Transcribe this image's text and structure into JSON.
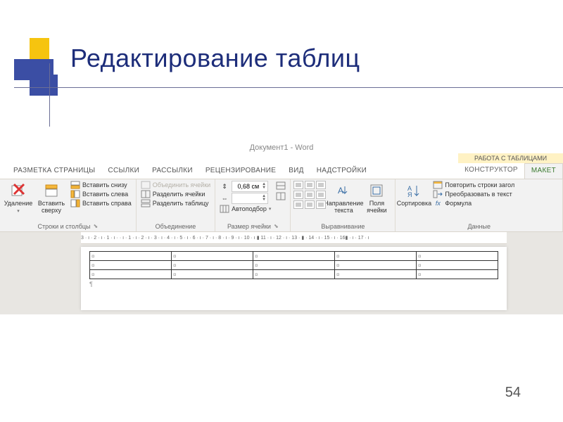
{
  "slide": {
    "title": "Редактирование таблиц",
    "number": "54"
  },
  "window": {
    "title": "Документ1 - Word"
  },
  "tabs": {
    "items": [
      "РАЗМЕТКА СТРАНИЦЫ",
      "ССЫЛКИ",
      "РАССЫЛКИ",
      "РЕЦЕНЗИРОВАНИЕ",
      "ВИД",
      "НАДСТРОЙКИ"
    ],
    "context_header": "РАБОТА С ТАБЛИЦАМИ",
    "context_items": [
      "КОНСТРУКТОР",
      "МАКЕТ"
    ],
    "active": "МАКЕТ"
  },
  "ribbon": {
    "rows_cols": {
      "delete": "Удаление",
      "insert_above": "Вставить сверху",
      "insert_below": "Вставить снизу",
      "insert_left": "Вставить слева",
      "insert_right": "Вставить справа",
      "label": "Строки и столбцы"
    },
    "merge": {
      "merge_cells": "Объединить ячейки",
      "split_cells": "Разделить ячейки",
      "split_table": "Разделить таблицу",
      "label": "Объединение"
    },
    "size": {
      "height": "0,68 см",
      "width": "",
      "autofit": "Автоподбор",
      "label": "Размер ячейки"
    },
    "align": {
      "direction": "Направление текста",
      "margins": "Поля ячейки",
      "label": "Выравнивание"
    },
    "data": {
      "sort": "Сортировка",
      "repeat": "Повторить строки загол",
      "convert": "Преобразовать в текст",
      "formula": "Формула",
      "label": "Данные"
    }
  },
  "ruler_text": "3 · ı · 2 · ı · 1 · ı ·   · ı · 1 · ı · 2 · ı · 3 · ı · 4 · ı · 5 · ı · 6 · ı · 7 · ı · 8 · ı · 9 · ı · 10 · ı ▮ 11 · ı · 12 · ı · 13 · ▮ · 14 · ı · 15 · ı · 16▮ · ı · 17 · ı",
  "cell_mark": "¤",
  "para_mark": "¶"
}
